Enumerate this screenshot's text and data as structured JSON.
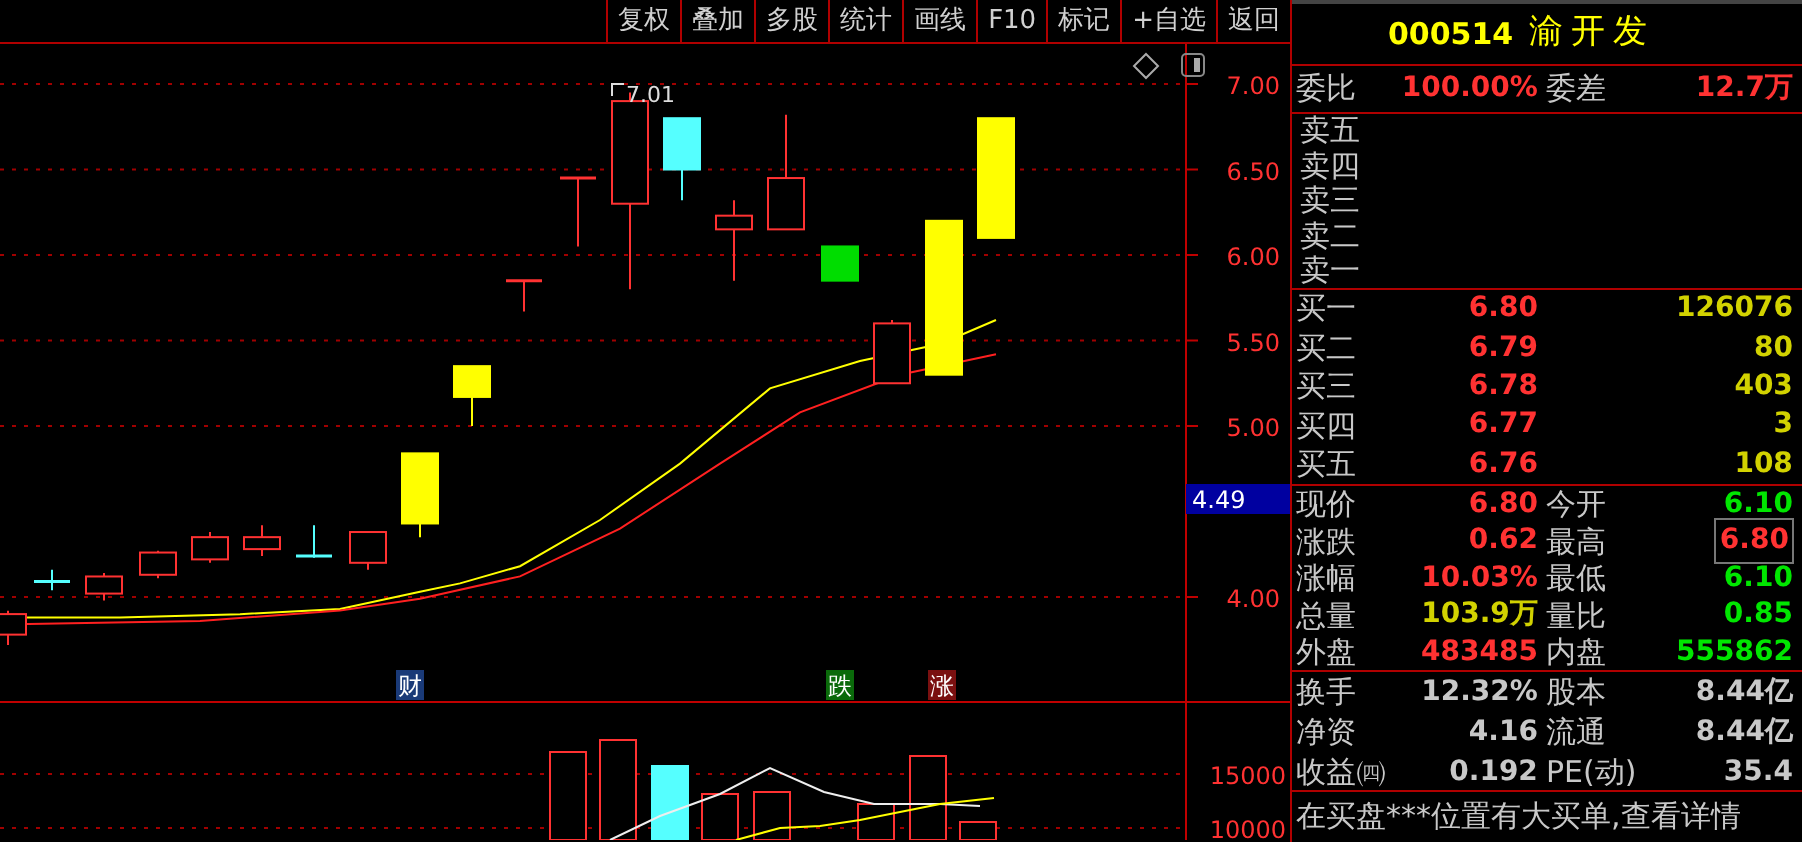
{
  "toolbar": [
    "复权",
    "叠加",
    "多股",
    "统计",
    "画线",
    "F10",
    "标记",
    "+自选",
    "返回"
  ],
  "price_chart": {
    "axis_labels": [
      "7.00",
      "6.50",
      "6.00",
      "5.50",
      "5.00",
      "4.00"
    ],
    "current_price_tag": "4.49",
    "high_marker": "7.01",
    "event_marks": [
      {
        "label": "财",
        "color": "#1a3a78"
      },
      {
        "label": "跌",
        "color": "#0a6a0a"
      },
      {
        "label": "涨",
        "color": "#7a1010"
      }
    ]
  },
  "volume_chart": {
    "axis_labels": [
      "15000",
      "10000"
    ]
  },
  "quote": {
    "code": "000514",
    "name": "渝开发",
    "order_ratio": [
      {
        "label": "委比",
        "value": "100.00%"
      },
      {
        "label": "委差",
        "value": "12.7万"
      }
    ],
    "asks": [
      "卖五",
      "卖四",
      "卖三",
      "卖二",
      "卖一"
    ],
    "bids": [
      {
        "label": "买一",
        "price": "6.80",
        "volume": "126076"
      },
      {
        "label": "买二",
        "price": "6.79",
        "volume": "80"
      },
      {
        "label": "买三",
        "price": "6.78",
        "volume": "403"
      },
      {
        "label": "买四",
        "price": "6.77",
        "volume": "3"
      },
      {
        "label": "买五",
        "price": "6.76",
        "volume": "108"
      }
    ],
    "stats": [
      [
        {
          "label": "现价",
          "value": "6.80",
          "color": "#ff3232",
          "boxed": false
        },
        {
          "label": "今开",
          "value": "6.10",
          "color": "#00e600",
          "boxed": false
        }
      ],
      [
        {
          "label": "涨跌",
          "value": "0.62",
          "color": "#ff3232",
          "boxed": false
        },
        {
          "label": "最高",
          "value": "6.80",
          "color": "#ff3232",
          "boxed": true
        }
      ],
      [
        {
          "label": "涨幅",
          "value": "10.03%",
          "color": "#ff3232",
          "boxed": false
        },
        {
          "label": "最低",
          "value": "6.10",
          "color": "#00e600",
          "boxed": false
        }
      ],
      [
        {
          "label": "总量",
          "value": "103.9万",
          "color": "#d2d200",
          "boxed": false
        },
        {
          "label": "量比",
          "value": "0.85",
          "color": "#00e600",
          "boxed": false
        }
      ],
      [
        {
          "label": "外盘",
          "value": "483485",
          "color": "#ff3232",
          "boxed": false
        },
        {
          "label": "内盘",
          "value": "555862",
          "color": "#00e600",
          "boxed": false
        }
      ]
    ],
    "fundamentals": [
      [
        {
          "label": "换手",
          "value": "12.32%"
        },
        {
          "label": "股本",
          "value": "8.44亿"
        }
      ],
      [
        {
          "label": "净资",
          "value": "4.16"
        },
        {
          "label": "流通",
          "value": "8.44亿"
        }
      ],
      [
        {
          "label": "收益㈣",
          "value": "0.192"
        },
        {
          "label": "PE(动)",
          "value": "35.4"
        }
      ]
    ],
    "message": "在买盘***位置有大买单,查看详情"
  }
}
